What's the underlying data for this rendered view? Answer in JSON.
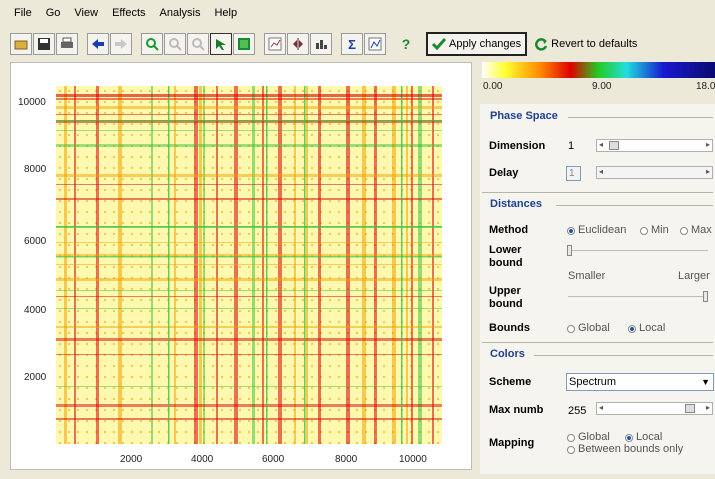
{
  "menu": [
    "File",
    "Go",
    "View",
    "Effects",
    "Analysis",
    "Help"
  ],
  "toolbar": {
    "apply_label": "Apply changes",
    "revert_label": "Revert to defaults",
    "sum_label": "Σ",
    "help_label": "?"
  },
  "colorbar": {
    "min": "0.00",
    "mid": "9.00",
    "max": "18.0"
  },
  "plot": {
    "y_ticks": [
      "10000",
      "8000",
      "6000",
      "4000",
      "2000"
    ],
    "x_ticks": [
      "2000",
      "4000",
      "6000",
      "8000",
      "10000"
    ]
  },
  "phase_space": {
    "title": "Phase Space",
    "dimension_label": "Dimension",
    "dimension_value": "1",
    "delay_label": "Delay",
    "delay_value": "1"
  },
  "distances": {
    "title": "Distances",
    "method_label": "Method",
    "method_options": [
      "Euclidean",
      "Min",
      "Max"
    ],
    "method_selected": "Euclidean",
    "lower_label_1": "Lower",
    "lower_label_2": "bound",
    "smaller_label": "Smaller",
    "larger_label": "Larger",
    "upper_label_1": "Upper",
    "upper_label_2": "bound",
    "bounds_label": "Bounds",
    "bounds_options": [
      "Global",
      "Local"
    ],
    "bounds_selected": "Local"
  },
  "colors": {
    "title": "Colors",
    "scheme_label": "Scheme",
    "scheme_value": "Spectrum",
    "maxnumb_label": "Max numb",
    "maxnumb_value": "255",
    "mapping_label": "Mapping",
    "mapping_options": [
      "Global",
      "Local",
      "Between bounds only"
    ],
    "mapping_selected": "Local"
  },
  "palette": {
    "bg": "#fff9b0",
    "orange": "#f0a000",
    "red": "#d80000",
    "green": "#3cc23c"
  }
}
